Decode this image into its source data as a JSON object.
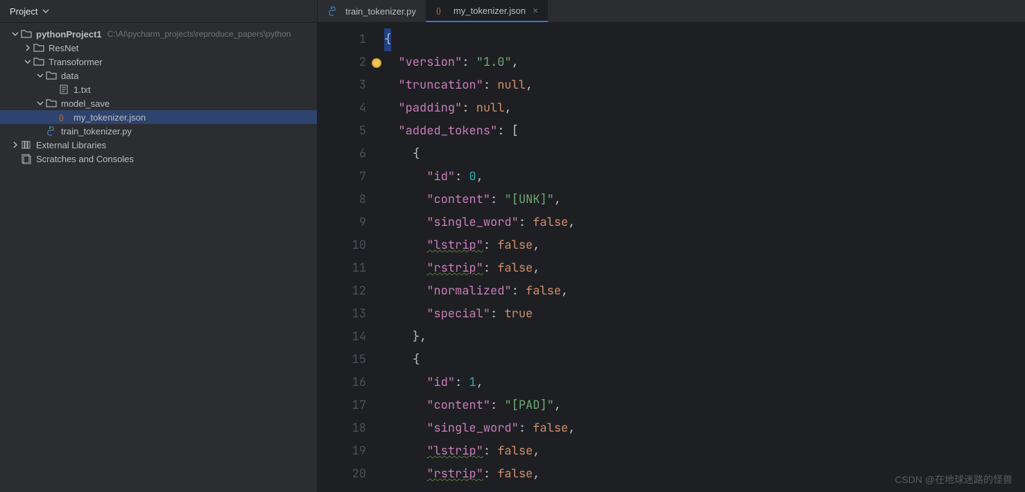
{
  "sidebar": {
    "title": "Project",
    "tree": {
      "root_name": "pythonProject1",
      "root_path": "C:\\AI\\pycharm_projects\\reproduce_papers\\python",
      "items": {
        "resnet": "ResNet",
        "transformer": "Transoformer",
        "data": "data",
        "txt": "1.txt",
        "model_save": "model_save",
        "my_tokenizer": "my_tokenizer.json",
        "train_tokenizer": "train_tokenizer.py",
        "external_libs": "External Libraries",
        "scratches": "Scratches and Consoles"
      }
    }
  },
  "tabs": [
    {
      "label": "train_tokenizer.py",
      "type": "py",
      "active": false
    },
    {
      "label": "my_tokenizer.json",
      "type": "json",
      "active": true
    }
  ],
  "line_numbers": [
    "1",
    "2",
    "3",
    "4",
    "5",
    "6",
    "7",
    "8",
    "9",
    "10",
    "11",
    "12",
    "13",
    "14",
    "15",
    "16",
    "17",
    "18",
    "19",
    "20"
  ],
  "code": {
    "l1_open": "{",
    "l2": {
      "key": "\"version\"",
      "sep": ": ",
      "val": "\"1.0\"",
      "end": ","
    },
    "l3": {
      "key": "\"truncation\"",
      "sep": ": ",
      "val": "null",
      "end": ","
    },
    "l4": {
      "key": "\"padding\"",
      "sep": ": ",
      "val": "null",
      "end": ","
    },
    "l5": {
      "key": "\"added_tokens\"",
      "sep": ": [",
      "end": ""
    },
    "l6": "{",
    "l7": {
      "key": "\"id\"",
      "sep": ": ",
      "val": "0",
      "end": ","
    },
    "l8": {
      "key": "\"content\"",
      "sep": ": ",
      "val": "\"[UNK]\"",
      "end": ","
    },
    "l9": {
      "key": "\"single_word\"",
      "sep": ": ",
      "val": "false",
      "end": ","
    },
    "l10": {
      "key": "\"lstrip\"",
      "sep": ": ",
      "val": "false",
      "end": ","
    },
    "l11": {
      "key": "\"rstrip\"",
      "sep": ": ",
      "val": "false",
      "end": ","
    },
    "l12": {
      "key": "\"normalized\"",
      "sep": ": ",
      "val": "false",
      "end": ","
    },
    "l13": {
      "key": "\"special\"",
      "sep": ": ",
      "val": "true",
      "end": ""
    },
    "l14": "},",
    "l15": "{",
    "l16": {
      "key": "\"id\"",
      "sep": ": ",
      "val": "1",
      "end": ","
    },
    "l17": {
      "key": "\"content\"",
      "sep": ": ",
      "val": "\"[PAD]\"",
      "end": ","
    },
    "l18": {
      "key": "\"single_word\"",
      "sep": ": ",
      "val": "false",
      "end": ","
    },
    "l19": {
      "key": "\"lstrip\"",
      "sep": ": ",
      "val": "false",
      "end": ","
    },
    "l20": {
      "key": "\"rstrip\"",
      "sep": ": ",
      "val": "false",
      "end": ","
    }
  },
  "watermark": "CSDN @在地球迷路的怪兽"
}
